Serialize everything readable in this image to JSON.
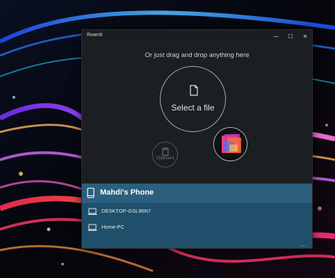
{
  "window": {
    "title": "Roamit"
  },
  "titlebar": {
    "minimize": "—",
    "maximize": "☐",
    "close": "✕"
  },
  "main": {
    "drop_hint": "Or just drag and drop anything here",
    "select_file_label": "Select a file",
    "clipboard_label": "Clipboard"
  },
  "devices": {
    "current": "Mahdi's Phone",
    "items": [
      {
        "name": "DESKTOP-GSL96N7"
      },
      {
        "name": "Home-PC"
      }
    ]
  },
  "footer": {
    "more_label": "..."
  },
  "colors": {
    "panel": "#1f4f6a",
    "panel_header": "#2a5f7d",
    "window_bg": "#1c1f22"
  }
}
